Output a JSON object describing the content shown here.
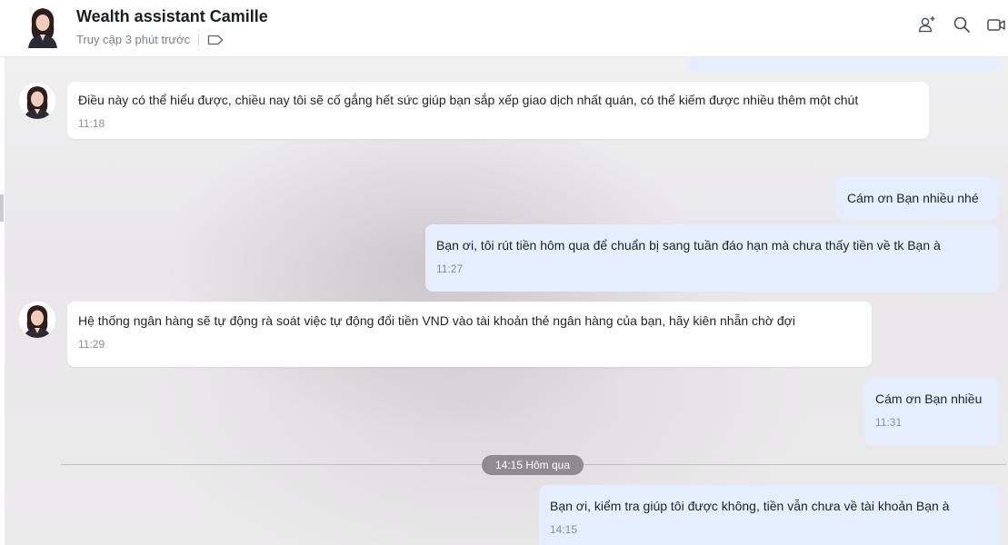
{
  "header": {
    "title": "Wealth assistant Camille",
    "status": "Truy cập 3 phút trước",
    "icons": [
      "add-member-icon",
      "search-icon",
      "video-call-icon",
      "tag-icon"
    ]
  },
  "messages": [
    {
      "direction": "in",
      "text": "Điều này có thể hiểu được, chiều nay tôi sẽ cố gắng hết sức giúp bạn sắp xếp giao dịch nhất quán, có thể kiếm được nhiều thêm một chút",
      "time": "11:18"
    },
    {
      "direction": "out",
      "text": "Cám ơn Bạn nhiều nhé",
      "time": ""
    },
    {
      "direction": "out",
      "text": "Bạn ơi,  tôi rút tiền hôm qua để chuẩn bị sang tuần đáo hạn mà chưa thấy tiền về tk Bạn à",
      "time": "11:27"
    },
    {
      "direction": "in",
      "text": "Hệ thống ngân hàng sẽ tự động rà soát việc tự động đổi tiền VND vào tài khoản thẻ ngân hàng của bạn, hãy kiên nhẫn chờ đợi",
      "time": "11:29"
    },
    {
      "direction": "out",
      "text": "Cám ơn Bạn nhiều",
      "time": "11:31"
    },
    {
      "direction": "out",
      "text": "Bạn ơi,  kiểm tra giúp tôi được không,  tiền vẫn chưa về tài khoản Bạn à",
      "time": "14:15"
    }
  ],
  "divider": {
    "label": "14:15 Hôm qua"
  },
  "colors": {
    "incoming_bubble": "#ffffff",
    "outgoing_bubble": "#e5eefe",
    "divider_pill": "#8e8c91"
  }
}
